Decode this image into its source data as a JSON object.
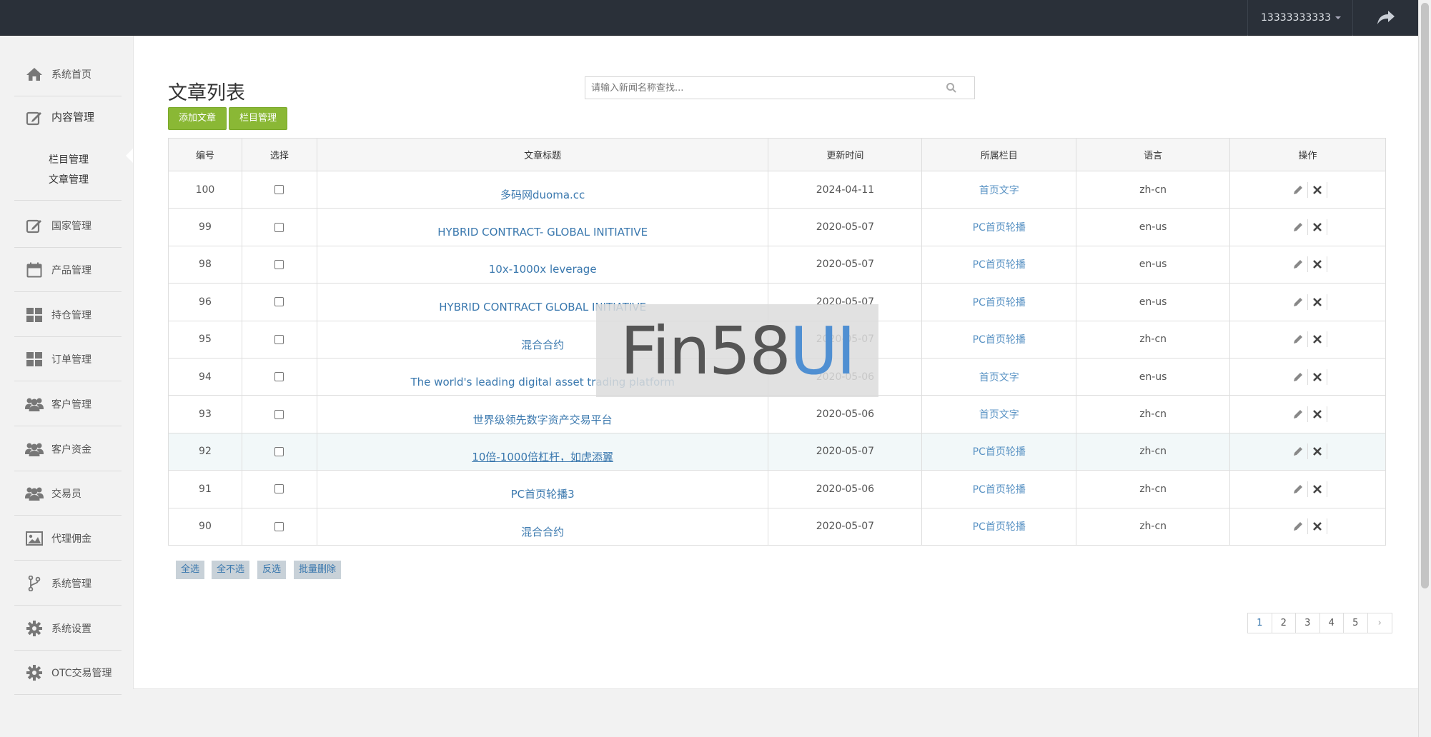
{
  "topbar": {
    "user": "13333333333"
  },
  "sidebar": {
    "items": [
      {
        "label": "系统首页",
        "icon": "home-icon"
      },
      {
        "label": "内容管理",
        "icon": "edit-icon",
        "active": true
      },
      {
        "label": "国家管理",
        "icon": "edit-icon"
      },
      {
        "label": "产品管理",
        "icon": "calendar-icon"
      },
      {
        "label": "持仓管理",
        "icon": "grid-icon"
      },
      {
        "label": "订单管理",
        "icon": "grid-icon"
      },
      {
        "label": "客户管理",
        "icon": "users-icon"
      },
      {
        "label": "客户资金",
        "icon": "users-icon"
      },
      {
        "label": "交易员",
        "icon": "users-icon"
      },
      {
        "label": "代理佣金",
        "icon": "picture-icon"
      },
      {
        "label": "系统管理",
        "icon": "branch-icon"
      },
      {
        "label": "系统设置",
        "icon": "gear-icon"
      },
      {
        "label": "OTC交易管理",
        "icon": "gear-icon"
      }
    ],
    "subitems": [
      "栏目管理",
      "文章管理"
    ]
  },
  "page": {
    "title": "文章列表",
    "search_placeholder": "请输入新闻名称查找...",
    "add_button": "添加文章",
    "column_button": "栏目管理"
  },
  "table": {
    "headers": [
      "编号",
      "选择",
      "文章标题",
      "更新时间",
      "所属栏目",
      "语言",
      "操作"
    ],
    "rows": [
      {
        "id": "100",
        "title": "多码网duoma.cc",
        "date": "2024-04-11",
        "column": "首页文字",
        "lang": "zh-cn"
      },
      {
        "id": "99",
        "title": "HYBRID CONTRACT- GLOBAL INITIATIVE",
        "date": "2020-05-07",
        "column": "PC首页轮播",
        "lang": "en-us"
      },
      {
        "id": "98",
        "title": "10x-1000x leverage",
        "date": "2020-05-07",
        "column": "PC首页轮播",
        "lang": "en-us"
      },
      {
        "id": "96",
        "title": "HYBRID CONTRACT GLOBAL INITIATIVE",
        "date": "2020-05-07",
        "column": "PC首页轮播",
        "lang": "en-us"
      },
      {
        "id": "95",
        "title": "混合合约",
        "date": "2020-05-07",
        "column": "PC首页轮播",
        "lang": "zh-cn"
      },
      {
        "id": "94",
        "title": "The world's leading digital asset trading platform",
        "date": "2020-05-06",
        "column": "首页文字",
        "lang": "en-us"
      },
      {
        "id": "93",
        "title": "世界级领先数字资产交易平台",
        "date": "2020-05-06",
        "column": "首页文字",
        "lang": "zh-cn"
      },
      {
        "id": "92",
        "title": "10倍-1000倍杠杆，如虎添翼",
        "date": "2020-05-07",
        "column": "PC首页轮播",
        "lang": "zh-cn",
        "highlight": true
      },
      {
        "id": "91",
        "title": "PC首页轮播3",
        "date": "2020-05-06",
        "column": "PC首页轮播",
        "lang": "zh-cn"
      },
      {
        "id": "90",
        "title": "混合合约",
        "date": "2020-05-07",
        "column": "PC首页轮播",
        "lang": "zh-cn"
      }
    ]
  },
  "bulk": {
    "select_all": "全选",
    "select_none": "全不选",
    "invert": "反选",
    "batch_delete": "批量删除"
  },
  "pagination": {
    "pages": [
      "1",
      "2",
      "3",
      "4",
      "5"
    ],
    "next": "›",
    "current": "1"
  },
  "watermark": {
    "part1": "Fin58",
    "part2": "UI"
  },
  "colors": {
    "topbar": "#2a3039",
    "accent_green": "#8ab835",
    "link_blue": "#3a78ae"
  }
}
